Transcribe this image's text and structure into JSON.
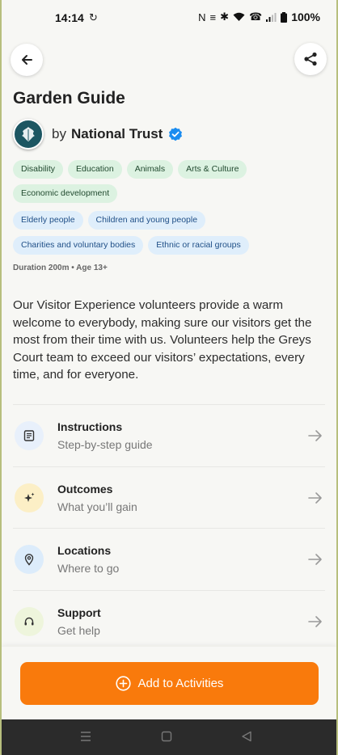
{
  "status_bar": {
    "time": "14:14",
    "battery": "100%"
  },
  "header": {
    "title": "Garden Guide"
  },
  "organization": {
    "by_label": "by",
    "name": "National Trust"
  },
  "tags": {
    "categories": [
      "Disability",
      "Education",
      "Animals",
      "Arts & Culture",
      "Economic development"
    ],
    "audiences": [
      "Elderly people",
      "Children and young people",
      "Charities and voluntary bodies",
      "Ethnic or racial groups"
    ]
  },
  "meta": "Duration 200m • Age 13+",
  "description": "Our Visitor Experience volunteers provide a warm welcome to everybody, making sure our visitors get the most from their time with us. Volunteers help the Greys Court team to exceed our visitors’ expectations, every time, and for everyone.",
  "menu": [
    {
      "label": "Instructions",
      "sub": "Step-by-step guide",
      "icon": "document-icon",
      "color": "#e8f0fb"
    },
    {
      "label": "Outcomes",
      "sub": "What you’ll gain",
      "icon": "sparkle-icon",
      "color": "#fcefc6"
    },
    {
      "label": "Locations",
      "sub": "Where to go",
      "icon": "location-pin-icon",
      "color": "#dcecfb"
    },
    {
      "label": "Support",
      "sub": "Get help",
      "icon": "support-icon",
      "color": "#eef5dc"
    }
  ],
  "cta": {
    "label": "Add to Activities",
    "color": "#f97a0c"
  }
}
